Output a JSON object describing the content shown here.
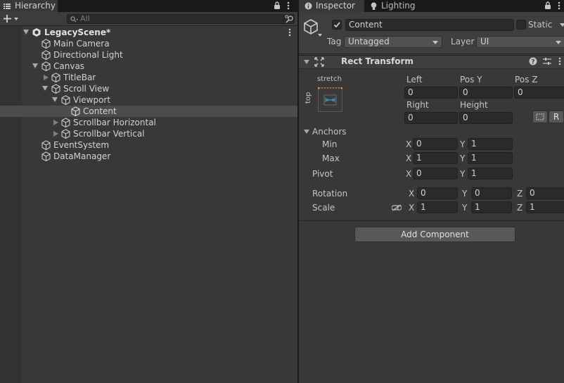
{
  "hierarchy": {
    "tab_label": "Hierarchy",
    "search_placeholder": "All",
    "items": [
      {
        "label": "LegacyScene*"
      },
      {
        "label": "Main Camera"
      },
      {
        "label": "Directional Light"
      },
      {
        "label": "Canvas"
      },
      {
        "label": "TitleBar"
      },
      {
        "label": "Scroll View"
      },
      {
        "label": "Viewport"
      },
      {
        "label": "Content"
      },
      {
        "label": "Scrollbar Horizontal"
      },
      {
        "label": "Scrollbar Vertical"
      },
      {
        "label": "EventSystem"
      },
      {
        "label": "DataManager"
      }
    ]
  },
  "inspector": {
    "tabs": [
      {
        "label": "Inspector"
      },
      {
        "label": "Lighting"
      }
    ],
    "object_name": "Content",
    "static_label": "Static",
    "tag_label": "Tag",
    "tag_value": "Untagged",
    "layer_label": "Layer",
    "layer_value": "UI",
    "rect_transform": {
      "title": "Rect Transform",
      "anchor_preset_top": "stretch",
      "anchor_preset_side": "top",
      "left_label": "Left",
      "left_value": "0",
      "posy_label": "Pos Y",
      "posy_value": "0",
      "posz_label": "Pos Z",
      "posz_value": "0",
      "right_label": "Right",
      "right_value": "0",
      "height_label": "Height",
      "height_value": "0",
      "r_button": "R",
      "anchors_label": "Anchors",
      "min_label": "Min",
      "min_x": "0",
      "min_y": "1",
      "max_label": "Max",
      "max_x": "1",
      "max_y": "1",
      "pivot_label": "Pivot",
      "pivot_x": "0",
      "pivot_y": "1",
      "rotation_label": "Rotation",
      "rot_x": "0",
      "rot_y": "0",
      "rot_z": "0",
      "scale_label": "Scale",
      "scale_x": "1",
      "scale_y": "1",
      "scale_z": "1",
      "axis_x": "X",
      "axis_y": "Y",
      "axis_z": "Z"
    },
    "add_component_label": "Add Component"
  },
  "colors": {
    "accent": "#3a79bb",
    "anchor_orange": "#e8913a",
    "selection": "#4c4c4c"
  }
}
